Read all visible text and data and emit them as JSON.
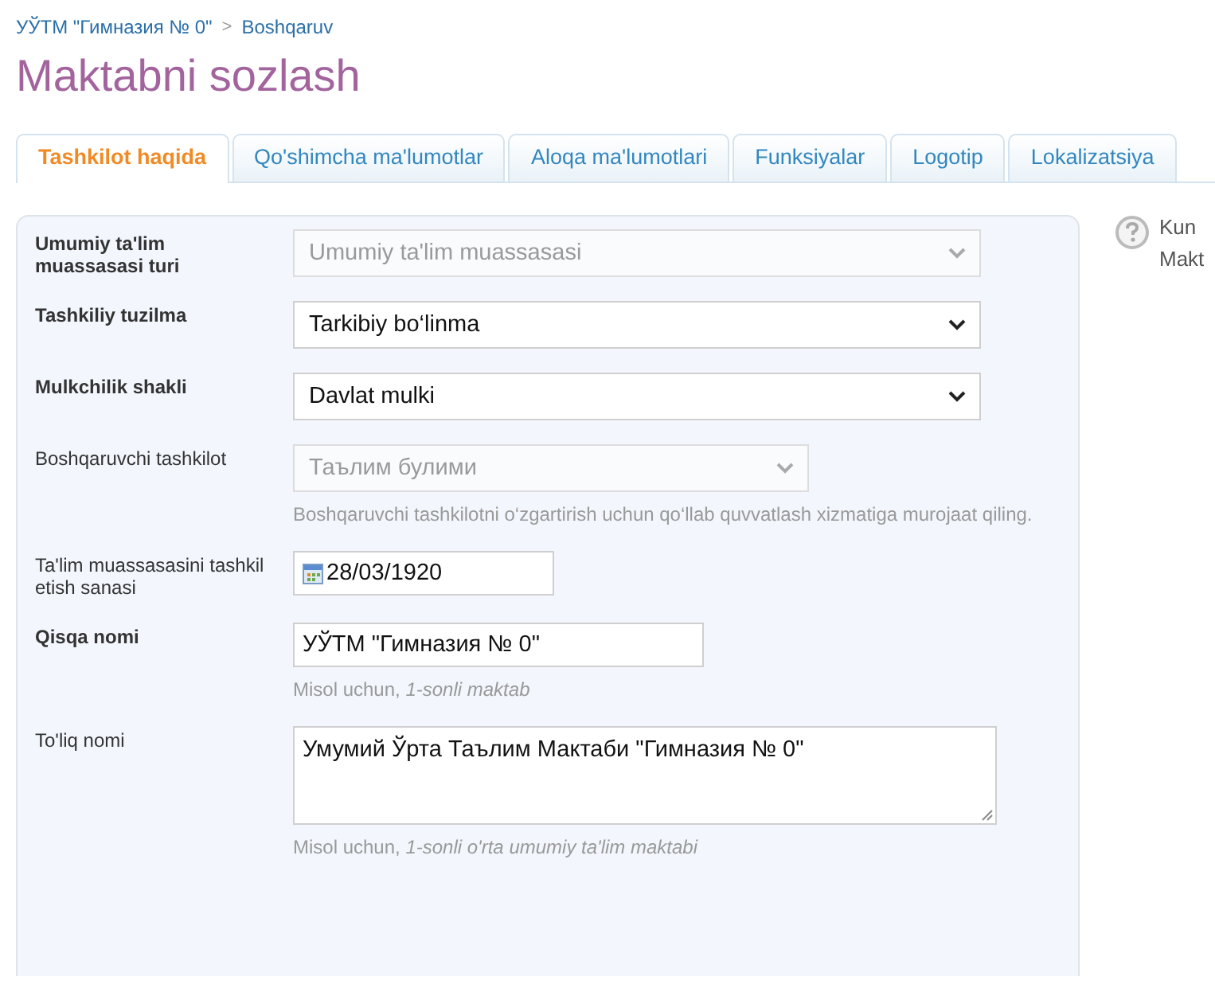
{
  "breadcrumb": [
    {
      "label": "УЎТМ \"Гимназия № 0\""
    },
    {
      "label": "Boshqaruv"
    }
  ],
  "breadcrumb_separator": ">",
  "title": "Maktabni sozlash",
  "tabs": [
    {
      "label": "Tashkilot haqida",
      "selected": true
    },
    {
      "label": "Qo'shimcha ma'lumotlar",
      "selected": false
    },
    {
      "label": "Aloqa ma'lumotlari",
      "selected": false
    },
    {
      "label": "Funksiyalar",
      "selected": false
    },
    {
      "label": "Logotip",
      "selected": false
    },
    {
      "label": "Lokalizatsiya",
      "selected": false
    }
  ],
  "form": [
    {
      "label": "Umumiy ta'lim muassasasi turi",
      "bold": true,
      "kind": "select",
      "value": "Umumiy ta'lim muassasasi",
      "disabled": true
    },
    {
      "label": "Tashkiliy tuzilma",
      "bold": true,
      "kind": "select",
      "value": "Tarkibiy bo‘linma",
      "disabled": false
    },
    {
      "label": "Mulkchilik shakli",
      "bold": true,
      "kind": "select",
      "value": "Davlat mulki",
      "disabled": false
    },
    {
      "label": "Boshqaruvchi tashkilot",
      "bold": false,
      "kind": "select",
      "value": "Таълим булими",
      "disabled": true,
      "hint": "Boshqaruvchi tashkilotni o‘zgartirish uchun qo‘llab quvvatlash xizmatiga murojaat qiling."
    },
    {
      "label": "Ta'lim muassasasini tashkil etish sanasi",
      "bold": false,
      "kind": "date",
      "value": "28/03/1920"
    },
    {
      "label": "Qisqa nomi",
      "bold": true,
      "kind": "text",
      "value": "УЎТМ \"Гимназия № 0\"",
      "hint": "Misol uchun, *1-sonli maktab*"
    },
    {
      "label": "To'liq nomi",
      "bold": false,
      "kind": "textarea",
      "value": "Умумий Ўрта Таълим Мактаби  \"Гимназия № 0\"",
      "hint": "Misol uchun, *1-sonli o'rta umumiy ta'lim maktabi*"
    }
  ],
  "help": {
    "lines": [
      "Kun",
      "Makt"
    ]
  }
}
